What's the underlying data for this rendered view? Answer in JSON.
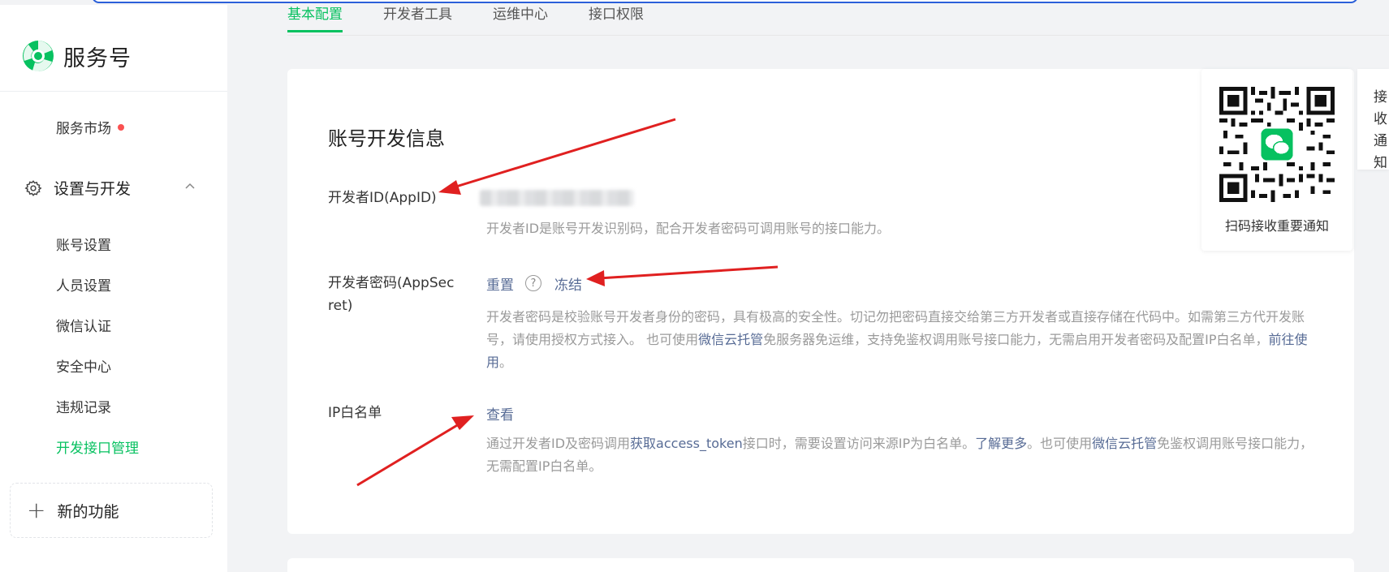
{
  "app": {
    "name": "服务号"
  },
  "tabs": [
    {
      "label": "基本配置",
      "active": true
    },
    {
      "label": "开发者工具",
      "active": false
    },
    {
      "label": "运维中心",
      "active": false
    },
    {
      "label": "接口权限",
      "active": false
    }
  ],
  "sidebar": {
    "market": "服务市场",
    "group_title": "设置与开发",
    "items": [
      {
        "label": "账号设置"
      },
      {
        "label": "人员设置"
      },
      {
        "label": "微信认证"
      },
      {
        "label": "安全中心"
      },
      {
        "label": "违规记录"
      },
      {
        "label": "开发接口管理",
        "active": true
      }
    ],
    "new_feature": "新的功能"
  },
  "card": {
    "title": "账号开发信息",
    "appid": {
      "label": "开发者ID(AppID)",
      "desc": "开发者ID是账号开发识别码，配合开发者密码可调用账号的接口能力。"
    },
    "secret": {
      "label": "开发者密码(AppSecret)",
      "reset": "重置",
      "help": "?",
      "freeze": "冻结",
      "desc_1": "开发者密码是校验账号开发者身份的密码，具有极高的安全性。切记勿把密码直接交给第三方开发者或直接存储在代码中。如需第三方代开发账号，请使用授权方式接入。 也可使用",
      "link_cloud": "微信云托管",
      "desc_2": "免服务器免运维，支持免鉴权调用账号接口能力，无需启用开发者密码及配置IP白名单，",
      "link_go": "前往使用",
      "desc_3": "。"
    },
    "ip": {
      "label": "IP白名单",
      "view": "查看",
      "desc_1": "通过开发者ID及密码调用",
      "link_token": "获取access_token",
      "desc_2": "接口时，需要设置访问来源IP为白名单。",
      "link_more": "了解更多",
      "desc_3": "。也可使用",
      "link_cloud": "微信云托管",
      "desc_4": "免鉴权调用账号接口能力，无需配置IP白名单。"
    }
  },
  "qr": {
    "caption": "扫码接收重要通知"
  },
  "side_notice": "接收通知",
  "colors": {
    "accent": "#07c160",
    "link": "#576b95",
    "alert": "#fa5151",
    "arrow": "#e02020"
  }
}
